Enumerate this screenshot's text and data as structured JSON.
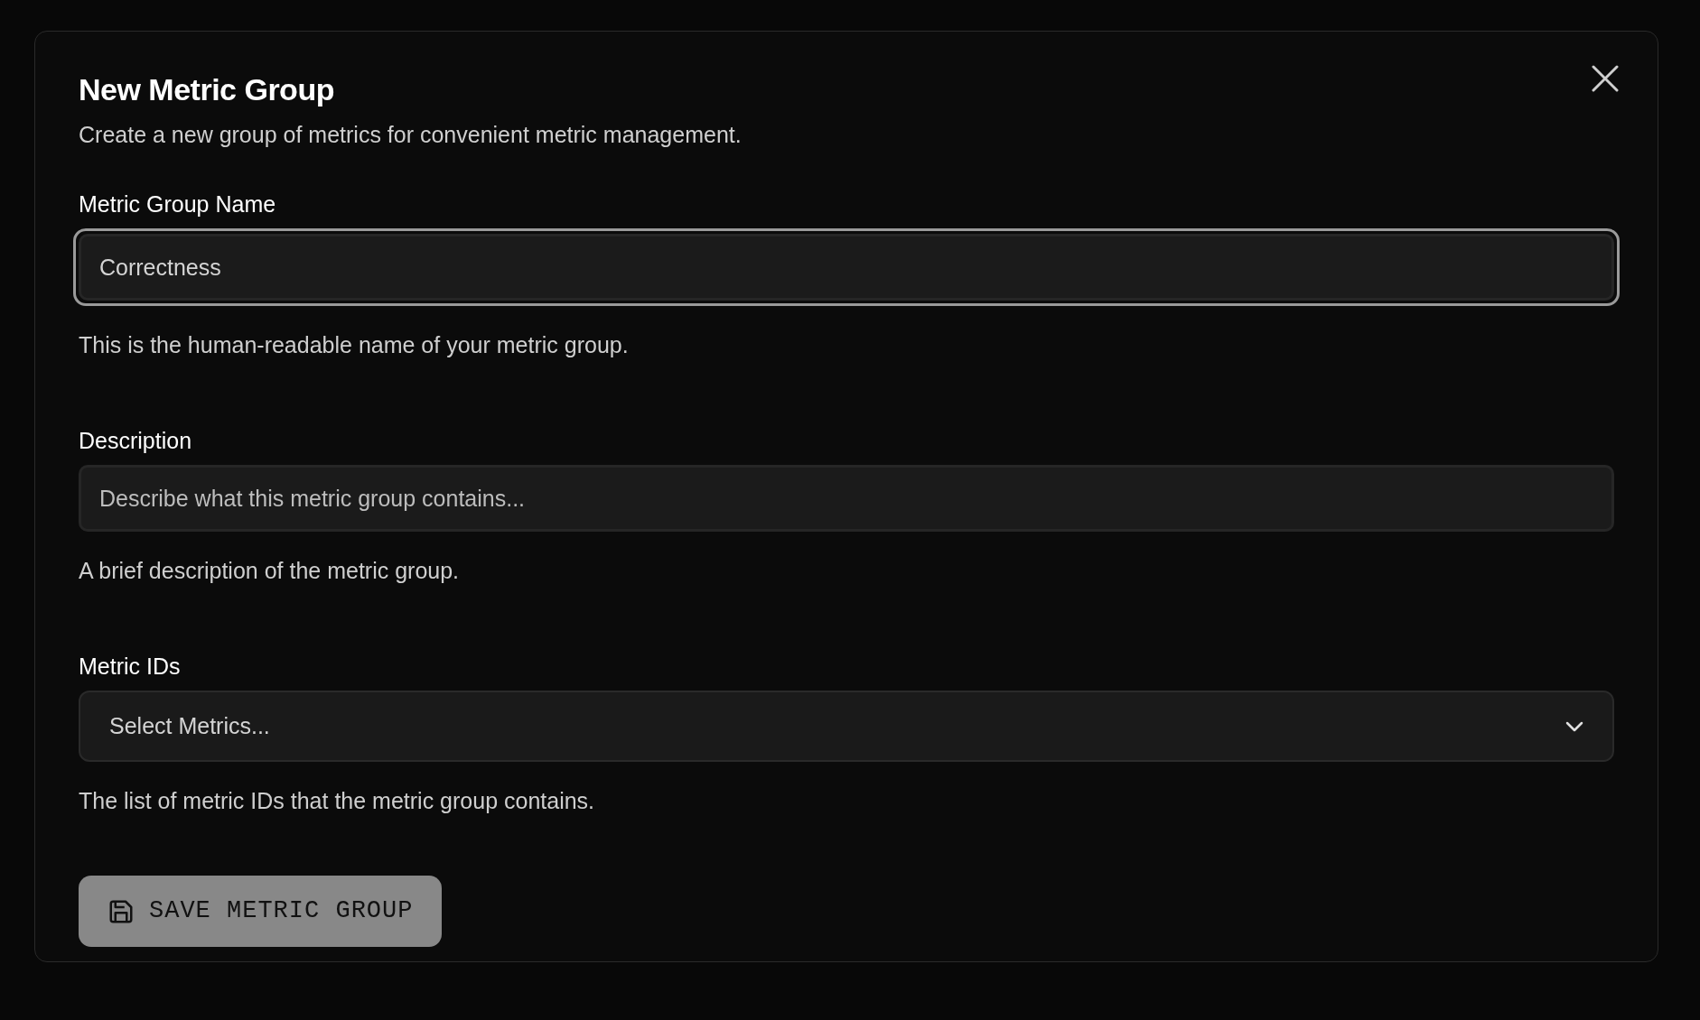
{
  "dialog": {
    "title": "New Metric Group",
    "description": "Create a new group of metrics for convenient metric management.",
    "fields": [
      {
        "kind": "input",
        "label": "Metric Group Name",
        "value": "Correctness",
        "focused": true,
        "help": "This is the human-readable name of your metric group."
      },
      {
        "kind": "input",
        "label": "Description",
        "placeholder": "Describe what this metric group contains...",
        "focused": false,
        "help": "A brief description of the metric group."
      },
      {
        "kind": "select",
        "label": "Metric IDs",
        "placeholder": "Select Metrics...",
        "focused": false,
        "help": "The list of metric IDs that the metric group contains."
      }
    ],
    "submit": {
      "label": "SAVE METRIC GROUP",
      "disabled": true
    }
  }
}
